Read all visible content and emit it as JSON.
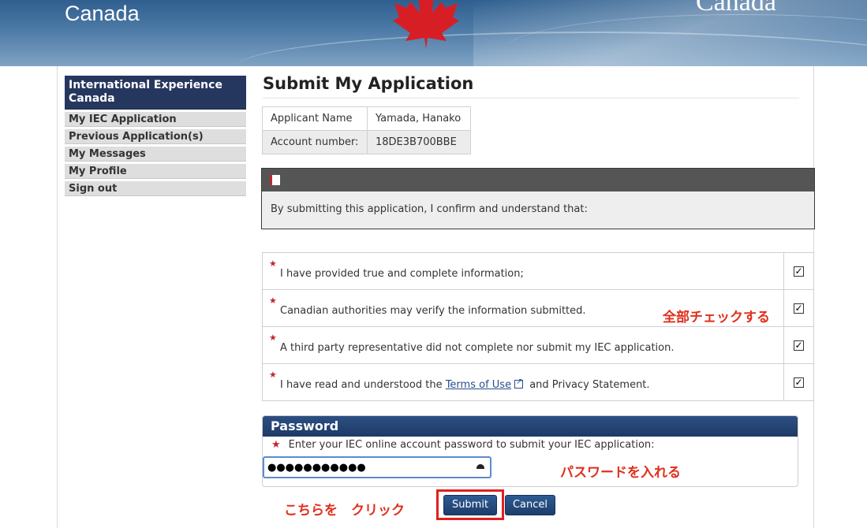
{
  "banner": {
    "left_text": "Canada",
    "right_text": "Canada"
  },
  "sidebar": {
    "title": "International Experience Canada",
    "items": [
      {
        "label": "My IEC Application"
      },
      {
        "label": "Previous Application(s)"
      },
      {
        "label": "My Messages"
      },
      {
        "label": "My Profile"
      },
      {
        "label": "Sign out"
      }
    ]
  },
  "main": {
    "title": "Submit My Application",
    "applicant": {
      "name_label": "Applicant Name",
      "name_value": "Yamada, Hanako",
      "account_label": "Account number:",
      "account_value": "18DE3B700BBE"
    },
    "notice_text": "By submitting this application, I confirm and understand that:",
    "declarations": [
      {
        "text": "I have provided true and complete information;",
        "checked": true
      },
      {
        "text": "Canadian authorities may verify the information submitted.",
        "checked": true
      },
      {
        "text": "A third party representative did not complete nor submit my IEC application.",
        "checked": true
      },
      {
        "text_before": "I have read and understood the ",
        "link": "Terms of Use",
        "text_after": " and Privacy Statement.",
        "checked": true
      }
    ],
    "password": {
      "heading": "Password",
      "label": "Enter your IEC online account password to submit your IEC application:",
      "value": "●●●●●●●●●●●"
    },
    "buttons": {
      "submit": "Submit",
      "cancel": "Cancel"
    }
  },
  "annotations": {
    "check_all": "全部チェックする",
    "enter_password": "パスワードを入れる",
    "click_here": "こちらを　クリック"
  },
  "colors": {
    "accent": "#26375f",
    "annotation": "#e0301e",
    "required": "#c0272d"
  }
}
